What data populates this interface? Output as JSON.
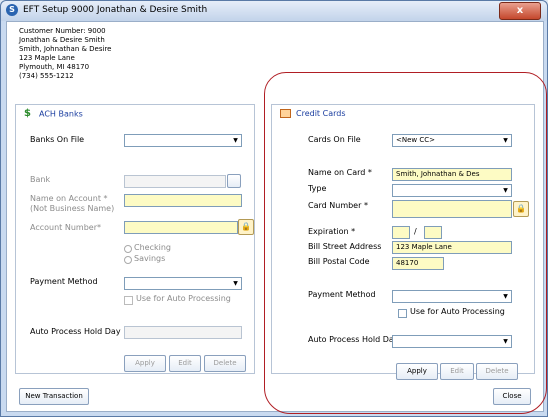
{
  "window": {
    "title": "EFT Setup 9000 Jonathan & Desire Smith",
    "close": "x"
  },
  "customer": {
    "number_line": "Customer Number: 9000",
    "name1": "Jonathan & Desire Smith",
    "name2": "Smith, Johnathan & Desire",
    "street": "123 Maple Lane",
    "city": "Plymouth, MI  48170",
    "phone": "(734) 555-1212"
  },
  "ach": {
    "header": "ACH Banks",
    "banks_on_file_label": "Banks On File",
    "bank_label": "Bank",
    "name_on_account_label": "Name on Account *",
    "not_business_label": "(Not Business Name)",
    "account_number_label": "Account Number*",
    "checking_label": "Checking",
    "savings_label": "Savings",
    "payment_method_label": "Payment Method",
    "auto_processing_label": "Use for Auto Processing",
    "hold_day_label": "Auto Process Hold Day",
    "apply": "Apply",
    "edit": "Edit",
    "delete": "Delete"
  },
  "cc": {
    "header": "Credit Cards",
    "cards_on_file_label": "Cards On File",
    "cards_on_file_value": "<New CC>",
    "name_on_card_label": "Name on Card *",
    "name_on_card_value": "Smith, Johnathan & Des",
    "type_label": "Type",
    "card_number_label": "Card Number *",
    "expiration_label": "Expiration *",
    "exp_sep": "/",
    "bill_street_label": "Bill Street Address",
    "bill_street_value": "123 Maple Lane",
    "bill_postal_label": "Bill Postal Code",
    "bill_postal_value": "48170",
    "payment_method_label": "Payment Method",
    "auto_processing_label": "Use for Auto Processing",
    "hold_day_label": "Auto Process Hold Day",
    "apply": "Apply",
    "edit": "Edit",
    "delete": "Delete"
  },
  "footer": {
    "new_transaction": "New Transaction",
    "close": "Close"
  },
  "colors": {
    "highlight": "#b01e24",
    "required_bg": "#fdfbc4",
    "header_text": "#1b3ea0"
  }
}
